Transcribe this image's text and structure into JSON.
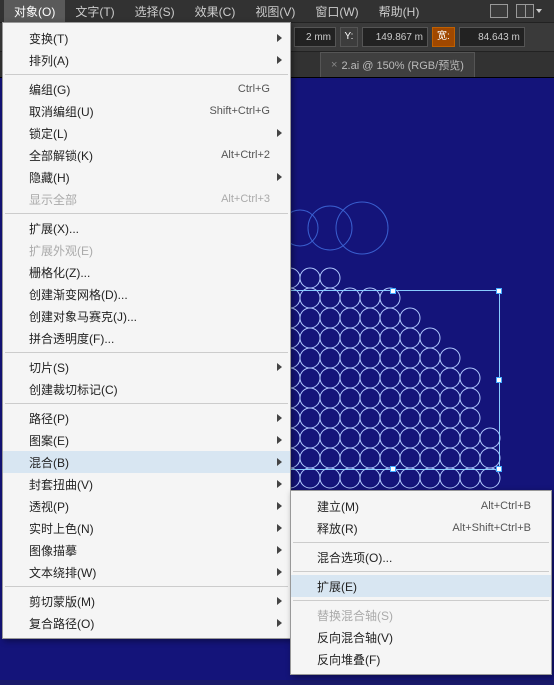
{
  "menubar": {
    "items": [
      "对象(O)",
      "文字(T)",
      "选择(S)",
      "效果(C)",
      "视图(V)",
      "窗口(W)",
      "帮助(H)"
    ]
  },
  "toolbar": {
    "x_suffix": "2 mm",
    "y_label": "Y:",
    "y_value": "149.867 m",
    "w_label": "宽:",
    "w_value": "84.643 m"
  },
  "tab": {
    "title": "2.ai @ 150% (RGB/预览)",
    "close": "×"
  },
  "menu": {
    "transform": "变换(T)",
    "arrange": "排列(A)",
    "group": "编组(G)",
    "group_sc": "Ctrl+G",
    "ungroup": "取消编组(U)",
    "ungroup_sc": "Shift+Ctrl+G",
    "lock": "锁定(L)",
    "unlockall": "全部解锁(K)",
    "unlockall_sc": "Alt+Ctrl+2",
    "hide": "隐藏(H)",
    "showall": "显示全部",
    "showall_sc": "Alt+Ctrl+3",
    "expand": "扩展(X)...",
    "expand_app": "扩展外观(E)",
    "rasterize": "栅格化(Z)...",
    "gradmesh": "创建渐变网格(D)...",
    "mosaic": "创建对象马赛克(J)...",
    "flatten": "拼合透明度(F)...",
    "slice": "切片(S)",
    "trim": "创建裁切标记(C)",
    "path": "路径(P)",
    "pattern": "图案(E)",
    "blend": "混合(B)",
    "envelope": "封套扭曲(V)",
    "perspective": "透视(P)",
    "livepaint": "实时上色(N)",
    "imagetrace": "图像描摹",
    "textwrap": "文本绕排(W)",
    "clipmask": "剪切蒙版(M)",
    "compound": "复合路径(O)"
  },
  "submenu": {
    "make": "建立(M)",
    "make_sc": "Alt+Ctrl+B",
    "release": "释放(R)",
    "release_sc": "Alt+Shift+Ctrl+B",
    "options": "混合选项(O)...",
    "expand": "扩展(E)",
    "replace": "替换混合轴(S)",
    "reverse": "反向混合轴(V)",
    "reversefb": "反向堆叠(F)"
  }
}
